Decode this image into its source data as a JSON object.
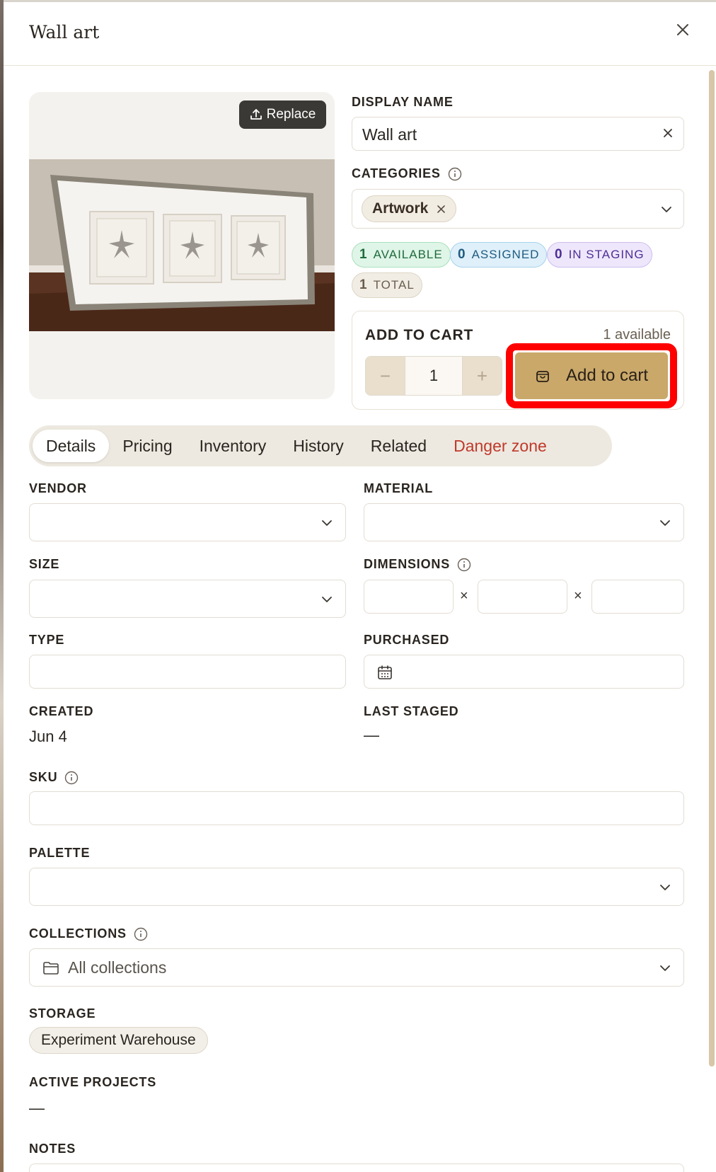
{
  "panel": {
    "title": "Wall art"
  },
  "image": {
    "replace_label": "Replace"
  },
  "display_name": {
    "label": "DISPLAY NAME",
    "value": "Wall art"
  },
  "categories": {
    "label": "CATEGORIES",
    "chip": "Artwork"
  },
  "badges": {
    "available": {
      "count": "1",
      "label": "AVAILABLE"
    },
    "assigned": {
      "count": "0",
      "label": "ASSIGNED"
    },
    "staging": {
      "count": "0",
      "label": "IN STAGING"
    },
    "total": {
      "count": "1",
      "label": "TOTAL"
    }
  },
  "cart": {
    "title": "ADD TO CART",
    "available": "1 available",
    "quantity": "1",
    "button": "Add to cart",
    "minus": "−",
    "plus": "+"
  },
  "tabs": [
    {
      "label": "Details",
      "active": true
    },
    {
      "label": "Pricing"
    },
    {
      "label": "Inventory"
    },
    {
      "label": "History"
    },
    {
      "label": "Related"
    },
    {
      "label": "Danger zone"
    }
  ],
  "fields": {
    "vendor": {
      "label": "VENDOR",
      "value": ""
    },
    "material": {
      "label": "MATERIAL",
      "value": ""
    },
    "size": {
      "label": "SIZE",
      "value": ""
    },
    "dimensions": {
      "label": "DIMENSIONS",
      "separator": "×"
    },
    "type": {
      "label": "TYPE",
      "value": ""
    },
    "purchased": {
      "label": "PURCHASED",
      "value": ""
    },
    "created": {
      "label": "CREATED",
      "value": "Jun 4"
    },
    "last_staged": {
      "label": "LAST STAGED",
      "value": "—"
    },
    "sku": {
      "label": "SKU",
      "value": ""
    },
    "palette": {
      "label": "PALETTE",
      "value": ""
    },
    "collections": {
      "label": "COLLECTIONS",
      "value": "All collections"
    },
    "storage": {
      "label": "STORAGE",
      "value": "Experiment Warehouse"
    },
    "active_projects": {
      "label": "ACTIVE PROJECTS",
      "value": "—"
    },
    "notes": {
      "label": "NOTES"
    }
  },
  "colors": {
    "accent": "#c9a86a",
    "danger": "#c0392b",
    "highlight": "#ff0000"
  }
}
